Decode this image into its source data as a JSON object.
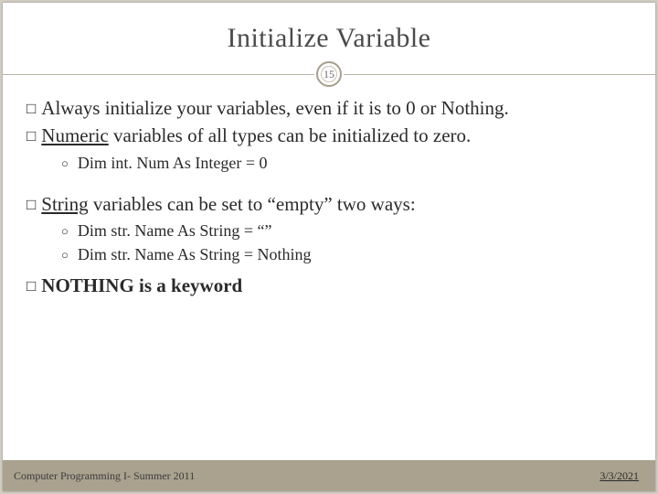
{
  "page_number": "15",
  "title": "Initialize Variable",
  "bullets": {
    "b1a": "Always initialize your variables, even if it is to 0 or Nothing.",
    "b1b_underline": "Numeric",
    "b1b_rest": " variables of all types can be initialized to zero.",
    "b2a": "Dim int. Num As Integer = 0",
    "b1c_underline": "String",
    "b1c_rest": " variables can be set to “empty” two ways:",
    "b2b": "Dim str. Name As String = “”",
    "b2c": "Dim str. Name As String = Nothing",
    "b1d": "NOTHING is a keyword"
  },
  "footer": {
    "left": "Computer Programming I- Summer 2011",
    "right": "3/3/2021"
  },
  "markers": {
    "square": "□",
    "circle": "○"
  }
}
